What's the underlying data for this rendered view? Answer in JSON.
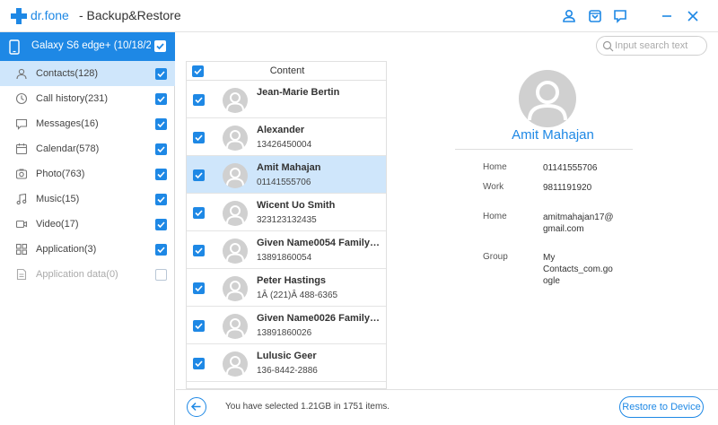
{
  "app": {
    "brand": "dr.fone",
    "title": "- Backup&Restore",
    "accent_color": "#1e88e5",
    "titlebar_icons": [
      "account-icon",
      "cart-icon",
      "feedback-icon",
      "minimize-icon",
      "close-icon"
    ]
  },
  "sidebar": {
    "device_name": "Galaxy S6 edge+ (10/18/2",
    "device_checked": true,
    "categories": [
      {
        "label": "Contacts(128)",
        "icon": "contacts-icon",
        "checked": true,
        "active": true,
        "disabled": false
      },
      {
        "label": "Call history(231)",
        "icon": "call-history-icon",
        "checked": true,
        "active": false,
        "disabled": false
      },
      {
        "label": "Messages(16)",
        "icon": "messages-icon",
        "checked": true,
        "active": false,
        "disabled": false
      },
      {
        "label": "Calendar(578)",
        "icon": "calendar-icon",
        "checked": true,
        "active": false,
        "disabled": false
      },
      {
        "label": "Photo(763)",
        "icon": "photo-icon",
        "checked": true,
        "active": false,
        "disabled": false
      },
      {
        "label": "Music(15)",
        "icon": "music-icon",
        "checked": true,
        "active": false,
        "disabled": false
      },
      {
        "label": "Video(17)",
        "icon": "video-icon",
        "checked": true,
        "active": false,
        "disabled": false
      },
      {
        "label": "Application(3)",
        "icon": "application-icon",
        "checked": true,
        "active": false,
        "disabled": false
      },
      {
        "label": "Application data(0)",
        "icon": "application-data-icon",
        "checked": false,
        "active": false,
        "disabled": true
      }
    ]
  },
  "search": {
    "placeholder": "Input search text",
    "value": ""
  },
  "list": {
    "header": "Content",
    "header_checked": true,
    "rows": [
      {
        "name": "Jean-Marie Bertin",
        "phone": "",
        "checked": true,
        "selected": false
      },
      {
        "name": "Alexander",
        "phone": "13426450004",
        "checked": true,
        "selected": false
      },
      {
        "name": "Amit Mahajan",
        "phone": "01141555706",
        "checked": true,
        "selected": true
      },
      {
        "name": "Wicent Uo Smith",
        "phone": "323123132435",
        "checked": true,
        "selected": false
      },
      {
        "name": "Given Name0054 Family Na...",
        "phone": "13891860054",
        "checked": true,
        "selected": false
      },
      {
        "name": "Peter Hastings",
        "phone": "1Â (221)Â 488-6365",
        "checked": true,
        "selected": false
      },
      {
        "name": "Given Name0026 Family Na...",
        "phone": "13891860026",
        "checked": true,
        "selected": false
      },
      {
        "name": "Lulusic Geer",
        "phone": "136-8442-2886",
        "checked": true,
        "selected": false
      }
    ]
  },
  "detail": {
    "name": "Amit Mahajan",
    "fields": [
      {
        "label": "Home",
        "value": "01141555706"
      },
      {
        "label": "Work",
        "value": "9811191920"
      },
      {
        "label": "Home",
        "value": "amitmahajan17@ gmail.com"
      },
      {
        "label": "Group",
        "value": "My Contacts_com.go ogle"
      }
    ]
  },
  "footer": {
    "status": "You have selected 1.21GB in 1751 items.",
    "restore_label": "Restore to Device"
  }
}
